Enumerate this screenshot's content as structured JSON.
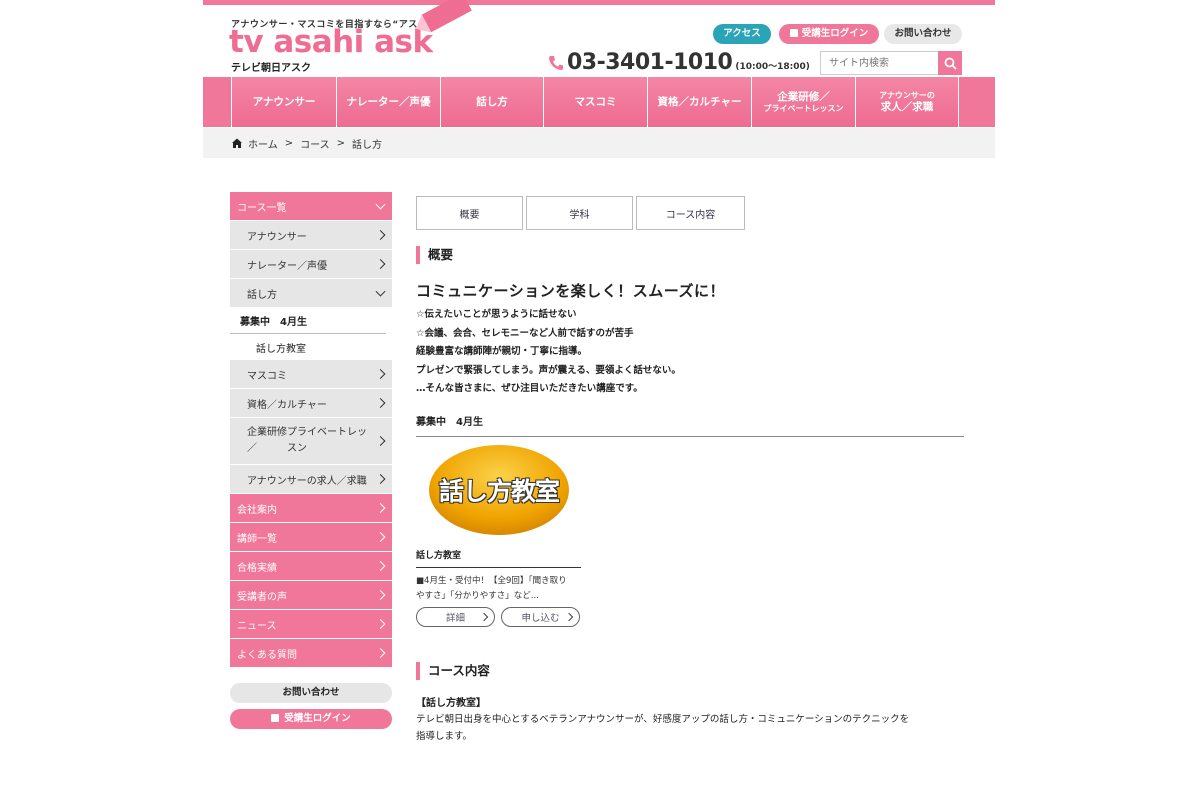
{
  "header": {
    "tagline": "アナウンサー・マスコミを目指すなら“アスク”",
    "logo_text": "tv asahi ask",
    "logo_sub": "テレビ朝日アスク",
    "buttons": {
      "access": "アクセス",
      "login": "受講生ログイン",
      "contact": "お問い合わせ"
    },
    "phone": "03-3401-1010",
    "phone_hours": "(10:00～18:00)",
    "search_placeholder": "サイト内検索",
    "icons": [
      "phone-icon",
      "lock-icon",
      "search-icon"
    ]
  },
  "nav": [
    {
      "label": "アナウンサー",
      "small": ""
    },
    {
      "label": "ナレーター／声優",
      "small": ""
    },
    {
      "label": "話し方",
      "small": ""
    },
    {
      "label": "マスコミ",
      "small": ""
    },
    {
      "label": "資格／カルチャー",
      "small": ""
    },
    {
      "label": "企業研修／",
      "small": "プライベートレッスン"
    },
    {
      "label": "求人／求職",
      "small": "アナウンサーの"
    }
  ],
  "breadcrumb": [
    "ホーム",
    "コース",
    "話し方"
  ],
  "sidebar": {
    "head": "コース一覧",
    "subs": [
      "アナウンサー",
      "ナレーター／声優",
      "話し方"
    ],
    "current_recruit": "募集中　4月生",
    "current_item": "話し方教室",
    "subs2": [
      "マスコミ",
      "資格／カルチャー"
    ],
    "corp_line1": "企業研修プライベートレッ",
    "corp_line2": "／　　　スン",
    "job": "アナウンサーの求人／求職",
    "links": [
      "会社案内",
      "講師一覧",
      "合格実績",
      "受講者の声",
      "ニュース",
      "よくある質問"
    ],
    "contact_button": "お問い合わせ",
    "login_button": "受講生ログイン"
  },
  "main": {
    "tabs": [
      "概要",
      "学科",
      "コース内容"
    ],
    "overview_heading": "概要",
    "lead": "コミュニケーションを楽しく！スムーズに！",
    "body_lines": [
      "☆伝えたいことが思うように話せない",
      "☆会議、会合、セレモニーなど人前で話すのが苦手",
      "経験豊富な講師陣が親切・丁寧に指導。",
      "プレゼンで緊張してしまう。声が震える、要領よく話せない。",
      "…そんな皆さまに、ぜひ注目いただきたい講座です。"
    ],
    "recruit": "募集中　4月生",
    "card": {
      "image_text": "話し方教室",
      "title": "話し方教室",
      "desc_line1": "■4月生・受付中！【全9回】「聞き取り",
      "desc_line2": "やすさ」「分かりやすさ」など...",
      "detail_button": "詳細",
      "apply_button": "申し込む"
    },
    "course_heading": "コース内容",
    "course_sub": "【話し方教室】",
    "course_text_line1": "テレビ朝日出身を中心とするベテランアナウンサーが、好感度アップの話し方・コミュニケーションのテクニックを",
    "course_text_line2": "指導します。"
  },
  "colors": {
    "brand_pink": "#f0779a",
    "access_teal": "#2aa4b7",
    "gray": "#e6e6e6"
  }
}
